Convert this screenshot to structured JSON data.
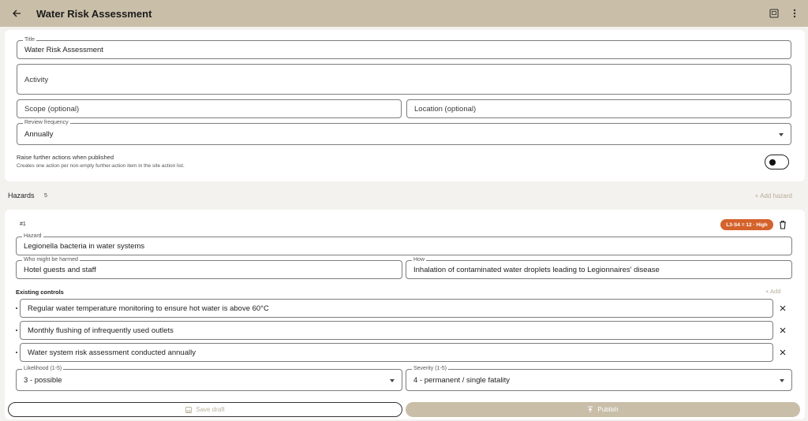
{
  "appbar": {
    "title": "Water Risk Assessment",
    "back_icon": "arrow-left-icon",
    "action_icons": [
      "preview-icon",
      "more-vert-icon"
    ]
  },
  "form": {
    "title": {
      "label": "Title",
      "value": "Water Risk Assessment"
    },
    "activity": {
      "placeholder": "Activity"
    },
    "scope": {
      "placeholder": "Scope (optional)"
    },
    "location": {
      "placeholder": "Location (optional)"
    },
    "review_frequency": {
      "label": "Review frequency",
      "value": "Annually"
    },
    "raise_actions": {
      "label": "Raise further actions when published",
      "help": "Creates one action per non-empty further-action item in the site action list.",
      "enabled": false
    }
  },
  "hazards": {
    "title": "Hazards",
    "count": "5",
    "add_label": "+ Add hazard",
    "items": [
      {
        "number": "#1",
        "badge": "L3·S4 = 12 · High",
        "badge_color": "#d4622b",
        "hazard": {
          "label": "Hazard",
          "value": "Legionella bacteria in water systems"
        },
        "who": {
          "label": "Who might be harmed",
          "value": "Hotel guests and staff"
        },
        "how": {
          "label": "How",
          "value": "Inhalation of contaminated water droplets leading to Legionnaires' disease"
        },
        "existing_controls": {
          "title": "Existing controls",
          "add_label": "+ Add",
          "items": [
            "Regular water temperature monitoring to ensure hot water is above 60°C",
            "Monthly flushing of infrequently used outlets",
            "Water system risk assessment conducted annually"
          ]
        },
        "likelihood": {
          "label": "Likelihood (1-5)",
          "value": "3 - possible"
        },
        "severity": {
          "label": "Severity (1-5)",
          "value": "4 - permanent / single fatality"
        }
      }
    ]
  },
  "footer": {
    "save_draft": "Save draft",
    "publish": "Publish"
  },
  "colors": {
    "appbar": "#c9bea8",
    "accent_muted": "#b8ad96",
    "risk_high": "#d4622b"
  }
}
